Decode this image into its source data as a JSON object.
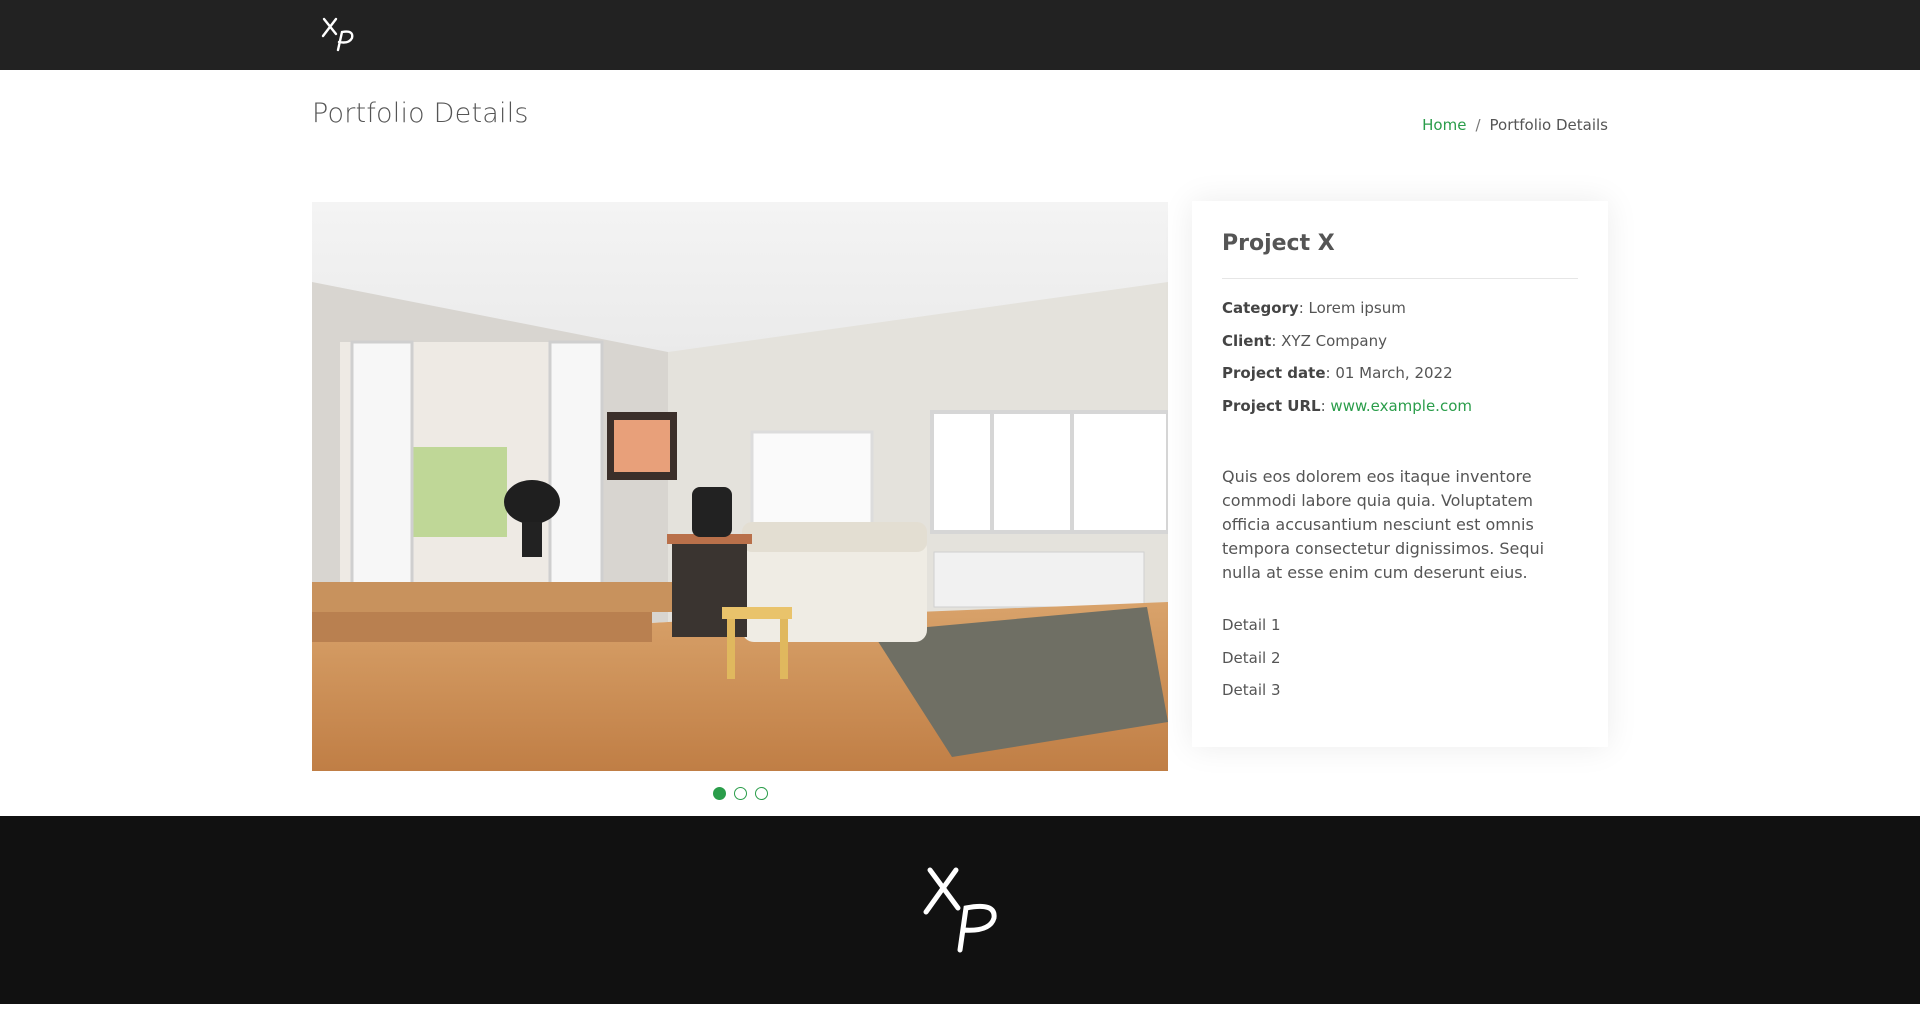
{
  "header": {
    "logo_icon": "xp-logo-icon"
  },
  "page": {
    "title": "Portfolio Details",
    "breadcrumb": {
      "home": "Home",
      "separator": "/",
      "current": "Portfolio Details"
    }
  },
  "slider": {
    "image_icon": "living-room-photo",
    "dots": [
      {
        "active": true
      },
      {
        "active": false
      },
      {
        "active": false
      }
    ]
  },
  "project": {
    "title": "Project X",
    "info": {
      "category_label": "Category",
      "category_value": "Lorem ipsum",
      "client_label": "Client",
      "client_value": "XYZ Company",
      "date_label": "Project date",
      "date_value": "01 March, 2022",
      "url_label": "Project URL",
      "url_value": "www.example.com"
    },
    "description": "Quis eos dolorem eos itaque inventore commodi labore quia quia. Voluptatem officia accusantium nesciunt est omnis tempora consectetur dignissimos. Sequi nulla at esse enim cum deserunt eius.",
    "details": [
      "Detail 1",
      "Detail 2",
      "Detail 3"
    ]
  },
  "footer": {
    "logo_icon": "xp-logo-icon"
  },
  "colors": {
    "accent": "#2a9d4a",
    "header_bg": "#222222",
    "footer_bg": "#111111"
  }
}
